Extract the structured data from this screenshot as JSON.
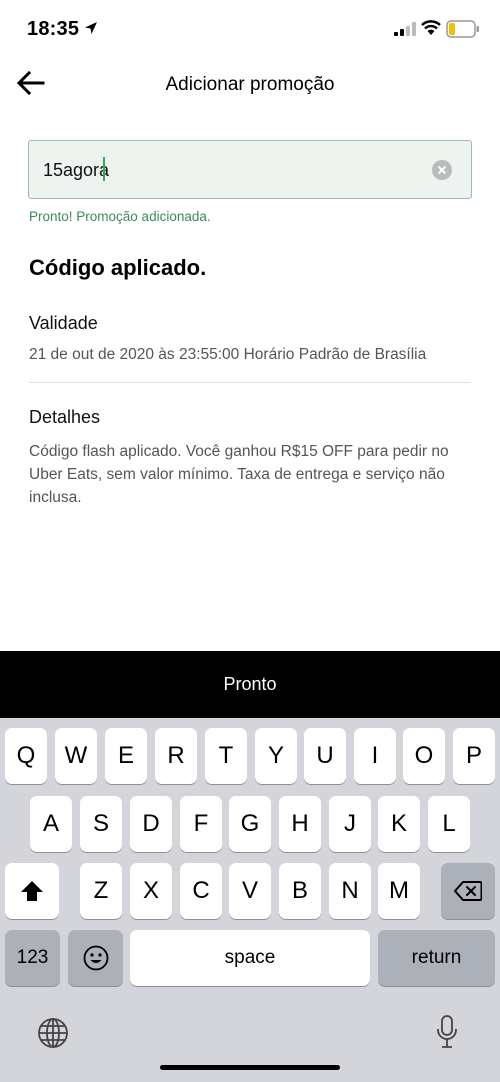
{
  "status_bar": {
    "time": "18:35"
  },
  "header": {
    "title": "Adicionar promoção"
  },
  "promo": {
    "input_value": "15agora",
    "success_message": "Pronto! Promoção adicionada."
  },
  "details": {
    "heading": "Código aplicado.",
    "validity_label": "Validade",
    "validity_value": "21 de out de 2020 às 23:55:00 Horário Padrão de Brasília",
    "details_label": "Detalhes",
    "details_text": "Código flash aplicado. Você ganhou R$15 OFF para pedir no Uber Eats, sem valor mínimo. Taxa de entrega e serviço não inclusa."
  },
  "done_bar": {
    "label": "Pronto"
  },
  "keyboard": {
    "row1": [
      "Q",
      "W",
      "E",
      "R",
      "T",
      "Y",
      "U",
      "I",
      "O",
      "P"
    ],
    "row2": [
      "A",
      "S",
      "D",
      "F",
      "G",
      "H",
      "J",
      "K",
      "L"
    ],
    "row3": [
      "Z",
      "X",
      "C",
      "V",
      "B",
      "N",
      "M"
    ],
    "numbers_label": "123",
    "space_label": "space",
    "return_label": "return"
  },
  "icons": {
    "back": "arrow-left-icon",
    "clear": "clear-circle-icon",
    "shift": "shift-icon",
    "backspace": "backspace-icon",
    "emoji": "emoji-icon",
    "globe": "globe-icon",
    "mic": "microphone-icon"
  },
  "colors": {
    "success": "#3d8b58",
    "input_border": "#99c0a2",
    "input_bg": "#eef3ef",
    "done_bar": "#000000",
    "keyboard_bg": "#d3d5db"
  }
}
